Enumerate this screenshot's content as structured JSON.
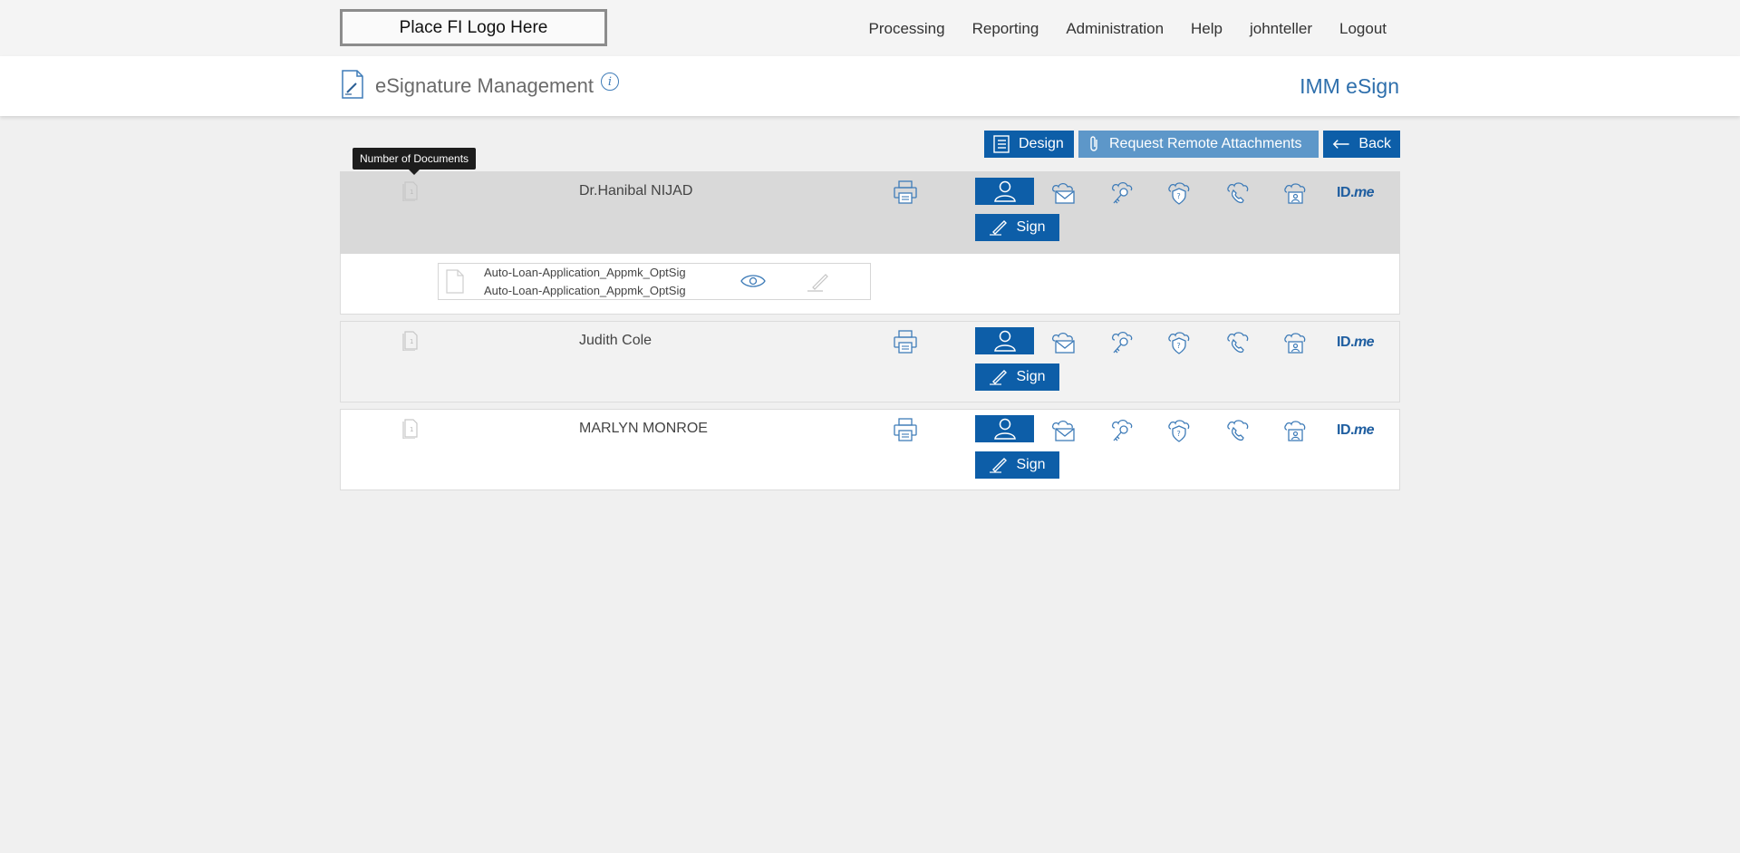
{
  "header": {
    "logo_text": "Place FI Logo Here",
    "nav": [
      "Processing",
      "Reporting",
      "Administration",
      "Help",
      "johnteller",
      "Logout"
    ]
  },
  "subheader": {
    "title": "eSignature Management",
    "info_glyph": "i",
    "app_name": "IMM eSign"
  },
  "actions": {
    "design": "Design",
    "request_remote_attachments": "Request Remote Attachments",
    "back": "Back"
  },
  "tooltip": "Number of Documents",
  "signers": [
    {
      "name": "Dr.Hanibal NIJAD",
      "doc_count": "1",
      "sign_label": "Sign",
      "idme": "ID.",
      "idme_suffix": "me"
    },
    {
      "name": "Judith Cole",
      "doc_count": "1",
      "sign_label": "Sign",
      "idme": "ID.",
      "idme_suffix": "me"
    },
    {
      "name": "MARLYN MONROE",
      "doc_count": "1",
      "sign_label": "Sign",
      "idme": "ID.",
      "idme_suffix": "me"
    }
  ],
  "document": {
    "line1": "Auto-Loan-Application_Appmk_OptSig",
    "line2": "Auto-Loan-Application_Appmk_OptSig"
  },
  "auth_icons": [
    "in-person-icon",
    "email-icon",
    "key-icon",
    "security-question-icon",
    "phone-icon",
    "cloud-id-icon"
  ],
  "colors": {
    "primary": "#0d5ea8",
    "primary_light": "#5d97c9",
    "app_name": "#2e6fac",
    "row_highlight": "#d9d9d9"
  }
}
